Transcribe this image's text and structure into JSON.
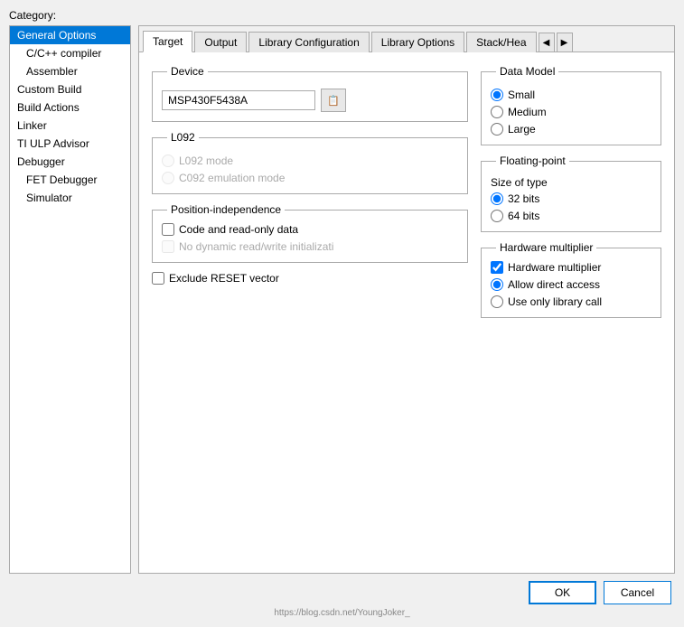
{
  "dialog": {
    "category_label": "Category:",
    "footer": {
      "ok_label": "OK",
      "cancel_label": "Cancel"
    }
  },
  "sidebar": {
    "items": [
      {
        "label": "General Options",
        "selected": true,
        "indented": false
      },
      {
        "label": "C/C++ compiler",
        "selected": false,
        "indented": true
      },
      {
        "label": "Assembler",
        "selected": false,
        "indented": true
      },
      {
        "label": "Custom Build",
        "selected": false,
        "indented": false
      },
      {
        "label": "Build Actions",
        "selected": false,
        "indented": false
      },
      {
        "label": "Linker",
        "selected": false,
        "indented": false
      },
      {
        "label": "TI ULP Advisor",
        "selected": false,
        "indented": false
      },
      {
        "label": "Debugger",
        "selected": false,
        "indented": false
      },
      {
        "label": "FET Debugger",
        "selected": false,
        "indented": true
      },
      {
        "label": "Simulator",
        "selected": false,
        "indented": true
      }
    ]
  },
  "tabs": [
    {
      "label": "Target",
      "active": true
    },
    {
      "label": "Output",
      "active": false
    },
    {
      "label": "Library Configuration",
      "active": false
    },
    {
      "label": "Library Options",
      "active": false
    },
    {
      "label": "Stack/Hea",
      "active": false
    }
  ],
  "target": {
    "device_section": "Device",
    "device_value": "MSP430F5438A",
    "device_btn_icon": "📋",
    "l092_section": "L092",
    "l092_mode_label": "L092 mode",
    "c092_mode_label": "C092 emulation mode",
    "position_section": "Position-independence",
    "code_readonly_label": "Code and read-only data",
    "no_dynamic_label": "No dynamic read/write initializati",
    "exclude_reset_label": "Exclude RESET vector",
    "data_model_section": "Data Model",
    "data_model_small": "Small",
    "data_model_medium": "Medium",
    "data_model_large": "Large",
    "floating_section": "Floating-point",
    "size_of_type_label": "Size of type",
    "bits32_label": "32 bits",
    "bits64_label": "64 bits",
    "hw_mult_section": "Hardware multiplier",
    "hw_mult_label": "Hardware multiplier",
    "allow_direct_label": "Allow direct access",
    "library_call_label": "Use only library call"
  },
  "watermark": "https://blog.csdn.net/YoungJoker_"
}
